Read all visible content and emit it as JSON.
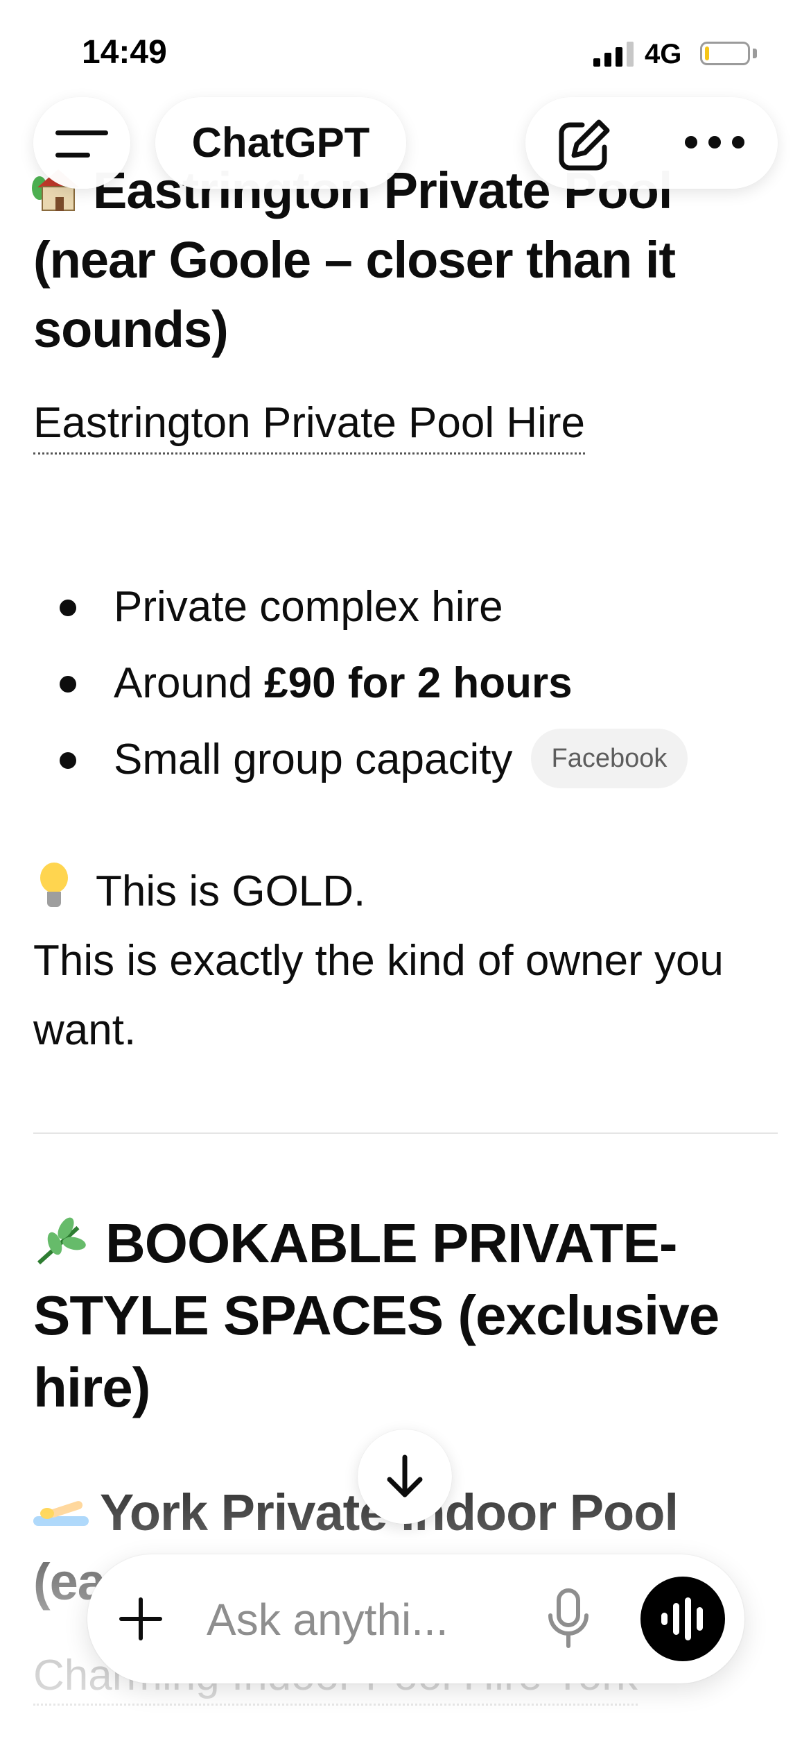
{
  "status_bar": {
    "time": "14:49",
    "network": "4G"
  },
  "top_nav": {
    "title": "ChatGPT"
  },
  "content": {
    "pool_heading": "Eastrington Private Pool (near Goole – closer than it sounds)",
    "pool_link": "Eastrington Private Pool Hire",
    "bullets": {
      "b1": "Private complex hire",
      "b2_prefix": "Around ",
      "b2_bold": "£90 for 2 hours",
      "b3": "Small group capacity",
      "b3_badge": "Facebook"
    },
    "tip_line1": "This is GOLD.",
    "tip_line2": "This is exactly the kind of owner you want.",
    "bookable_heading": "BOOKABLE PRIVATE-STYLE SPACES (exclusive hire)",
    "york_heading": "York Private Indoor Pool (easy win)",
    "charming_link": "Charming Indoor Pool Hire York"
  },
  "composer": {
    "placeholder": "Ask anythi..."
  },
  "icons": {
    "menu": "hamburger-menu-icon",
    "edit": "new-chat-edit-icon",
    "more": "more-dots-icon",
    "scroll": "arrow-down-icon",
    "plus": "plus-icon",
    "mic": "microphone-icon",
    "voice": "voice-waveform-icon",
    "house": "house-with-garden-emoji",
    "bulb": "light-bulb-emoji",
    "herb": "herb-emoji",
    "swimmer": "swimmer-emoji"
  },
  "colors": {
    "text": "#0d0d0d",
    "placeholder": "#8e8e8e",
    "badge_bg": "#f2f2f2",
    "voice_button": "#000000",
    "battery_level": "#f5c518"
  }
}
